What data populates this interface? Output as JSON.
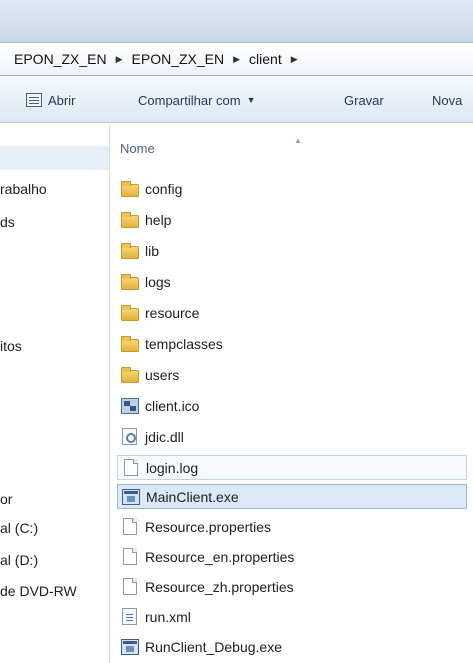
{
  "address": {
    "crumbs": [
      "EPON_ZX_EN",
      "EPON_ZX_EN",
      "client"
    ]
  },
  "toolbar": {
    "open_label": "Abrir",
    "share_label": "Compartilhar com",
    "burn_label": "Gravar",
    "new_label": "Nova"
  },
  "nav": {
    "items": [
      "rabalho",
      "ds",
      "itos",
      "or",
      "al (C:)",
      "al (D:)",
      "de DVD-RW"
    ]
  },
  "content": {
    "column_header": "Nome",
    "files": [
      {
        "name": "config",
        "icon": "folder-icon"
      },
      {
        "name": "help",
        "icon": "folder-icon"
      },
      {
        "name": "lib",
        "icon": "folder-icon"
      },
      {
        "name": "logs",
        "icon": "folder-icon"
      },
      {
        "name": "resource",
        "icon": "folder-icon"
      },
      {
        "name": "tempclasses",
        "icon": "folder-icon"
      },
      {
        "name": "users",
        "icon": "folder-icon"
      },
      {
        "name": "client.ico",
        "icon": "image-file-icon"
      },
      {
        "name": "jdic.dll",
        "icon": "dll-file-icon"
      },
      {
        "name": "login.log",
        "icon": "text-file-icon"
      },
      {
        "name": "MainClient.exe",
        "icon": "exe-file-icon"
      },
      {
        "name": "Resource.properties",
        "icon": "text-file-icon"
      },
      {
        "name": "Resource_en.properties",
        "icon": "text-file-icon"
      },
      {
        "name": "Resource_zh.properties",
        "icon": "text-file-icon"
      },
      {
        "name": "run.xml",
        "icon": "xml-file-icon"
      },
      {
        "name": "RunClient_Debug.exe",
        "icon": "exe-file-icon"
      }
    ]
  },
  "colors": {
    "selection": "#dce8f6",
    "hover": "#f7fafd",
    "toolbar_text": "#1e3956"
  }
}
